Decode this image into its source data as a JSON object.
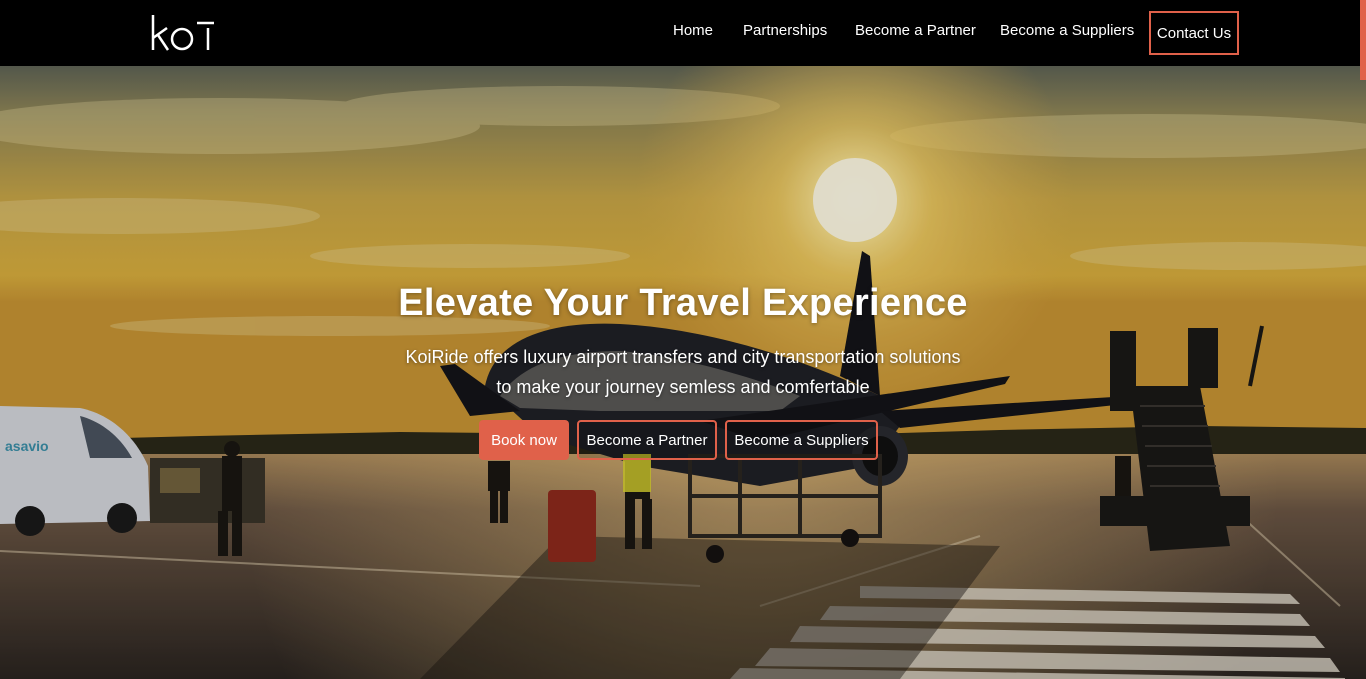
{
  "brand": {
    "logo_text": "koi",
    "accent_color": "#e0614a"
  },
  "nav": {
    "items": [
      {
        "label": "Home"
      },
      {
        "label": "Partnerships"
      },
      {
        "label": "Become a Partner"
      },
      {
        "label": "Become a Suppliers"
      }
    ],
    "contact_label": "Contact Us"
  },
  "hero": {
    "title": "Elevate Your Travel Experience",
    "subtitle_line1": "KoiRide offers luxury airport transfers and city transportation solutions",
    "subtitle_line2": "to make your journey semless and comfertable",
    "buttons": {
      "book": "Book now",
      "partner": "Become a Partner",
      "supplier": "Become a Suppliers"
    },
    "background": "airport-apron-sunset-image"
  }
}
